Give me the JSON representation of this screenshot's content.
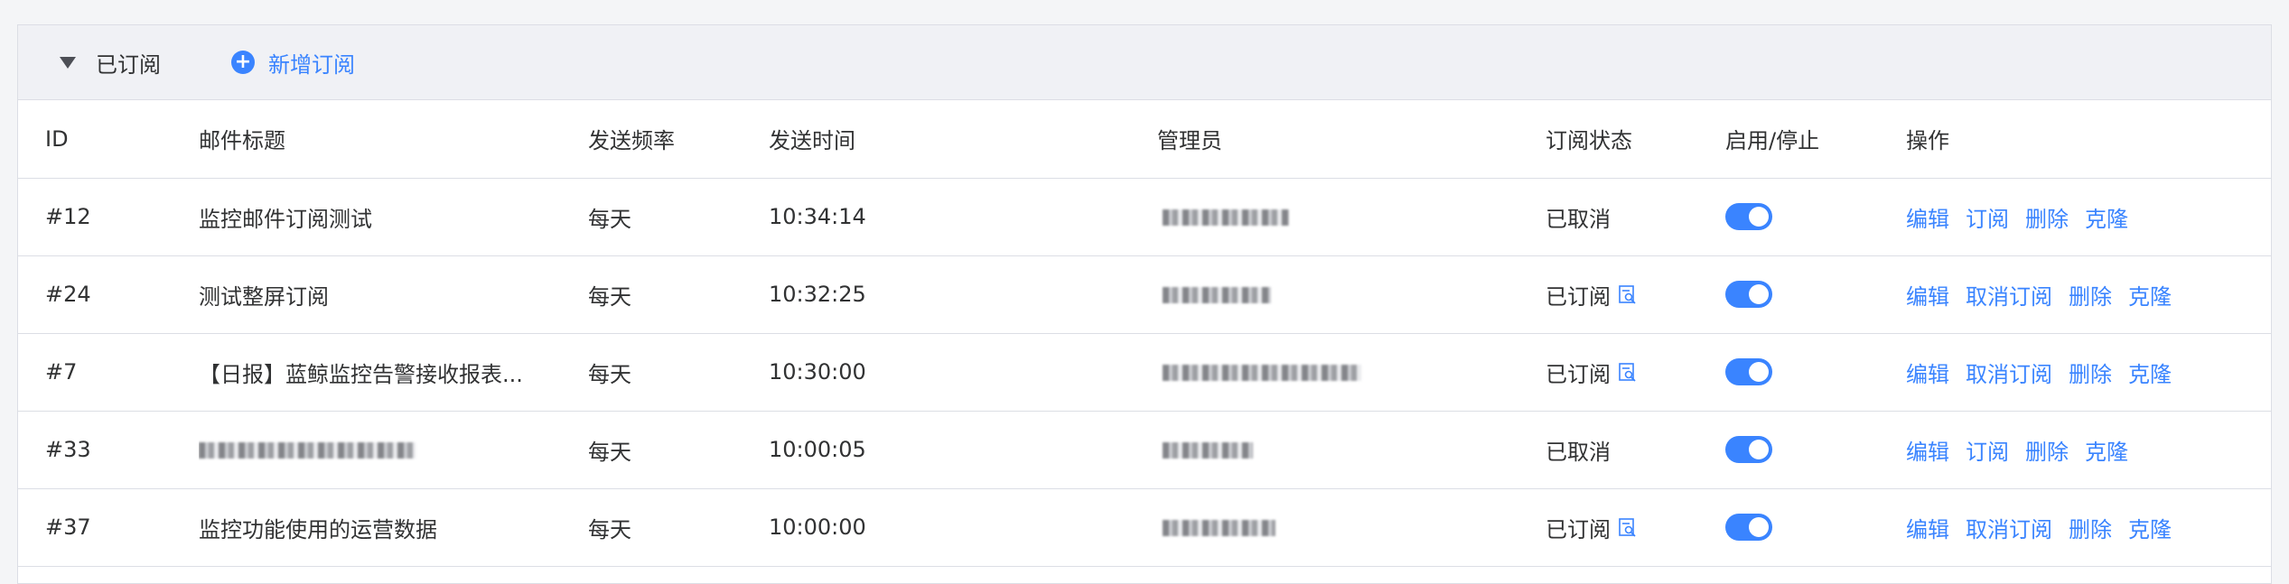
{
  "panel": {
    "title": "已订阅",
    "add_label": "新增订阅",
    "icons": {
      "collapse": "caret-down-icon",
      "add": "plus-circle-icon"
    }
  },
  "columns": [
    "ID",
    "邮件标题",
    "发送频率",
    "发送时间",
    "管理员",
    "订阅状态",
    "启用/停止",
    "操作"
  ],
  "rows": [
    {
      "id": "#12",
      "title": "监控邮件订阅测试",
      "title_redacted": false,
      "frequency": "每天",
      "time": "10:34:14",
      "status": "已取消",
      "status_icon": false,
      "enabled": true,
      "actions": [
        "编辑",
        "订阅",
        "删除",
        "克隆"
      ]
    },
    {
      "id": "#24",
      "title": "测试整屏订阅",
      "title_redacted": false,
      "frequency": "每天",
      "time": "10:32:25",
      "status": "已订阅",
      "status_icon": true,
      "enabled": true,
      "actions": [
        "编辑",
        "取消订阅",
        "删除",
        "克隆"
      ]
    },
    {
      "id": "#7",
      "title": "【日报】蓝鲸监控告警接收报表...",
      "title_redacted": false,
      "frequency": "每天",
      "time": "10:30:00",
      "status": "已订阅",
      "status_icon": true,
      "enabled": true,
      "actions": [
        "编辑",
        "取消订阅",
        "删除",
        "克隆"
      ]
    },
    {
      "id": "#33",
      "title": "",
      "title_redacted": true,
      "frequency": "每天",
      "time": "10:00:05",
      "status": "已取消",
      "status_icon": false,
      "enabled": true,
      "actions": [
        "编辑",
        "订阅",
        "删除",
        "克隆"
      ]
    },
    {
      "id": "#37",
      "title": "监控功能使用的运营数据",
      "title_redacted": false,
      "frequency": "每天",
      "time": "10:00:00",
      "status": "已订阅",
      "status_icon": true,
      "enabled": true,
      "actions": [
        "编辑",
        "取消订阅",
        "删除",
        "克隆"
      ]
    }
  ],
  "colors": {
    "accent": "#3a84ff",
    "text": "#313233",
    "border": "#dcdee5",
    "header_bg": "#f0f1f5"
  }
}
